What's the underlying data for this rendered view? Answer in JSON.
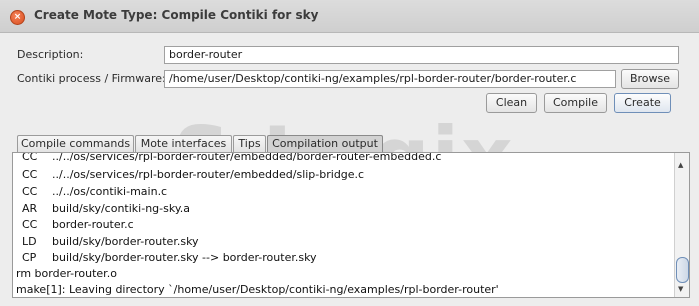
{
  "window": {
    "title": "Create Mote Type: Compile Contiki for sky",
    "close_icon": "close-icon"
  },
  "form": {
    "description_label": "Description:",
    "description_value": "border-router",
    "firmware_label": "Contiki process / Firmware:",
    "firmware_value": "/home/user/Desktop/contiki-ng/examples/rpl-border-router/border-router.c",
    "browse_label": "Browse",
    "clean_label": "Clean",
    "compile_label": "Compile",
    "create_label": "Create"
  },
  "tabs": [
    {
      "label": "Compile commands",
      "active": false
    },
    {
      "label": "Mote interfaces",
      "active": false
    },
    {
      "label": "Tips",
      "active": false
    },
    {
      "label": "Compilation output",
      "active": true
    }
  ],
  "output_lines": [
    {
      "tag": "CC",
      "text": "../../os/services/rpl-border-router/embedded/border-router-embedded.c"
    },
    {
      "tag": "CC",
      "text": "../../os/services/rpl-border-router/embedded/slip-bridge.c"
    },
    {
      "tag": "CC",
      "text": "../../os/contiki-main.c"
    },
    {
      "tag": "AR",
      "text": "build/sky/contiki-ng-sky.a"
    },
    {
      "tag": "CC",
      "text": "border-router.c"
    },
    {
      "tag": "LD",
      "text": "build/sky/border-router.sky"
    },
    {
      "tag": "CP",
      "text": "build/sky/border-router.sky --> border-router.sky"
    },
    {
      "tag": "",
      "text": "rm border-router.o"
    },
    {
      "tag": "",
      "text": "make[1]: Leaving directory `/home/user/Desktop/contiki-ng/examples/rpl-border-router'"
    }
  ],
  "watermark": "S Logix"
}
